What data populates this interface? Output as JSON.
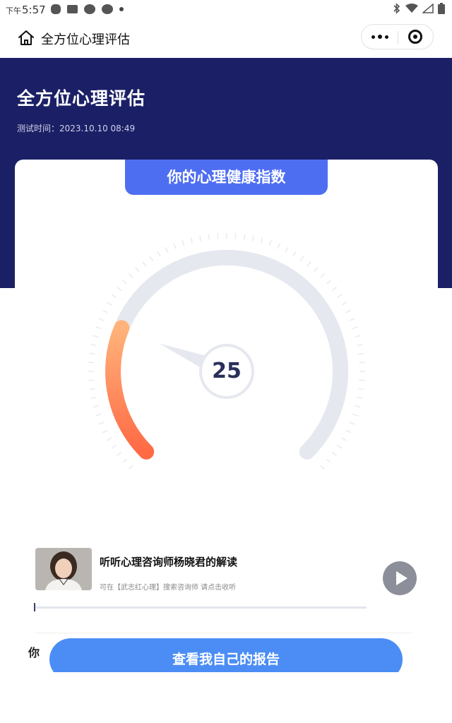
{
  "status_bar": {
    "ampm": "下午",
    "time": "5:57"
  },
  "nav": {
    "title": "全方位心理评估"
  },
  "hero": {
    "title": "全方位心理评估",
    "test_time": "测试时间：2023.10.10 08:49",
    "background_color": "#1b2066"
  },
  "card": {
    "header": "你的心理健康指数",
    "header_color": "#4e6ef2"
  },
  "gauge": {
    "score": "25",
    "fill_fraction": 0.25,
    "gradient_start": "#ffb37a",
    "gradient_end": "#ff6a45",
    "track_color": "#e6e8ef"
  },
  "audio": {
    "title": "听听心理咨询师杨晓君的解读",
    "subtitle": "可在【武志红心理】搜索咨询师  请点击收听",
    "progress": 0.0
  },
  "section": {
    "label": "你"
  },
  "report_button": {
    "label": "查看我自己的报告",
    "color": "#4b8df5"
  }
}
